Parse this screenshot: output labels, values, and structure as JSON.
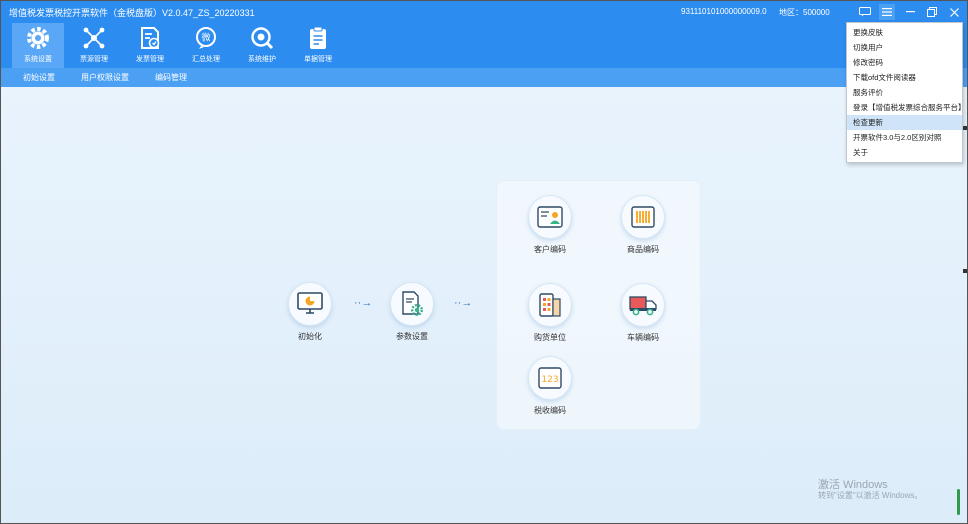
{
  "titlebar": {
    "title": "增值税发票税控开票软件（金税盘版）V2.0.47_ZS_20220331",
    "tax_no": "931110101000000009.0",
    "region": "地区：500000"
  },
  "toolbar": {
    "items": [
      {
        "label": "系统设置",
        "icon": "gear-icon",
        "active": true
      },
      {
        "label": "票源管理",
        "icon": "network-icon"
      },
      {
        "label": "发票管理",
        "icon": "invoice-icon"
      },
      {
        "label": "汇总处理",
        "icon": "summary-icon"
      },
      {
        "label": "系统维护",
        "icon": "maintenance-icon"
      },
      {
        "label": "单据管理",
        "icon": "clipboard-icon"
      }
    ]
  },
  "subnav": {
    "items": [
      "初始设置",
      "用户权限设置",
      "编码管理"
    ]
  },
  "flow": {
    "init": "初始化",
    "params": "参数设置",
    "arrow": "→",
    "customer": "客户编码",
    "product": "商品编码",
    "buyer": "购货单位",
    "vehicle": "车辆编码",
    "taxcode": "税收编码",
    "taxcode_digits": "123"
  },
  "menu": {
    "items": [
      "更换皮肤",
      "切换用户",
      "修改密码",
      "下载ofd文件阅读器",
      "服务评价",
      "登录【增值税发票综合服务平台】",
      "检查更新",
      "开票软件3.0与2.0区别对照",
      "关于"
    ],
    "hover_index": 6
  },
  "watermark": {
    "line1": "激活 Windows",
    "line2": "转到\"设置\"以激活 Windows。"
  },
  "colors": {
    "header_blue": "#2d8cf0",
    "subnav_blue": "#4ba0f4",
    "accent_orange": "#f5a623",
    "accent_red": "#e85a5a",
    "accent_green": "#38b48b"
  }
}
